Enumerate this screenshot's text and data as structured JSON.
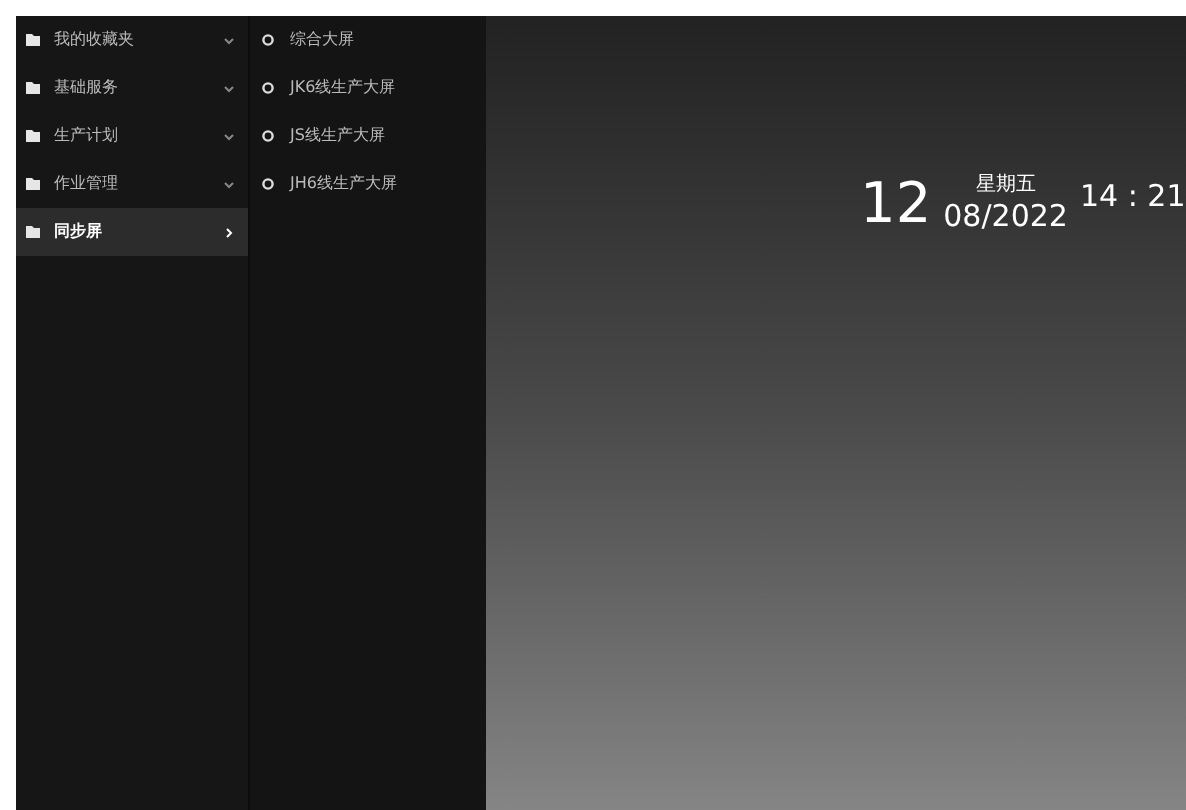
{
  "menu": [
    {
      "label": "我的收藏夹",
      "selected": false
    },
    {
      "label": "基础服务",
      "selected": false
    },
    {
      "label": "生产计划",
      "selected": false
    },
    {
      "label": "作业管理",
      "selected": false
    },
    {
      "label": "同步屏",
      "selected": true
    }
  ],
  "submenu": [
    "综合大屏",
    "JK6线生产大屏",
    "JS线生产大屏",
    "JH6线生产大屏"
  ],
  "clock": {
    "day": "12",
    "weekday": "星期五",
    "month_year": "08/2022",
    "time": "14 : 21"
  }
}
